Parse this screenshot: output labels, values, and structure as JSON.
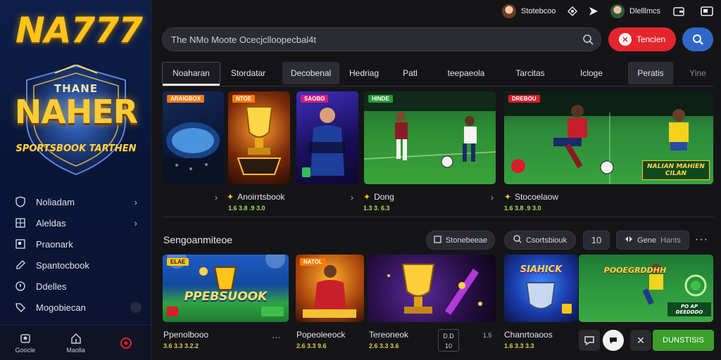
{
  "brand": {
    "logo": "NA777"
  },
  "promo": {
    "top": "THANE",
    "main": "NAHER",
    "sub": "SPORTSBOOK TARTHEN"
  },
  "sidebar": {
    "items": [
      {
        "label": "Noliadam",
        "icon": "shield-icon"
      },
      {
        "label": "Aleldas",
        "icon": "grid-icon"
      },
      {
        "label": "Praonark",
        "icon": "square-icon"
      },
      {
        "label": "Spantocbook",
        "icon": "edit-icon"
      },
      {
        "label": "Ddelles",
        "icon": "circle-info-icon"
      },
      {
        "label": "Mogobiecan",
        "icon": "tag-icon"
      }
    ],
    "bottom": [
      {
        "label": "Goocle",
        "icon": "home-icon"
      },
      {
        "label": "Maolla",
        "icon": "house-outline-icon"
      },
      {
        "label": "",
        "icon": "record-icon"
      }
    ]
  },
  "topbar": {
    "user1": "Stotebcoo",
    "user2": "Dlelllmcs"
  },
  "search": {
    "placeholder": "The NMo Moote Ocecjclloopecbal4t"
  },
  "actions": {
    "red_button": "Tencien"
  },
  "tabs": [
    "Noaharan",
    "Stordatar",
    "Decobenal",
    "Hedriag",
    "Patl",
    "teepaeola",
    "Tarcitas",
    "Icloge",
    "Peratis",
    "Yine"
  ],
  "featured": [
    {
      "tag": "ARAIGBOX",
      "caption": "Anoirrtsbook",
      "odds": "1.6 3.8 .9 3.0"
    },
    {
      "tag": "NTOE",
      "caption": "",
      "odds": ""
    },
    {
      "tag": "SAOBO",
      "caption": "",
      "odds": ""
    },
    {
      "tag": "HINDE",
      "caption": "Dong",
      "odds": "1.3 3. 6.3"
    },
    {
      "tag": "DREBOU",
      "caption": "Stocoelaow",
      "odds": "1.6 3.8 .9 3.0",
      "banner": "NALIAN MAHIEN CILAN"
    }
  ],
  "section": {
    "title": "Sengoanmiteoe",
    "filters": [
      "Stonebeeae",
      "Csortsbiouk",
      "10",
      "Gene",
      "Hants"
    ]
  },
  "games": [
    {
      "tag": "ELAE",
      "title": "PPEBSUOOK",
      "caption": "Ppenolbooo",
      "odds": "3.6 3.3 3.2.2"
    },
    {
      "tag": "NATOL",
      "title": "",
      "caption": "Popeoleeock",
      "odds": "2.6 3.3 9.6"
    },
    {
      "tag": "",
      "title": "",
      "caption": "Tereoneok",
      "odds": "2.6 3.3 3.6"
    },
    {
      "tag": "",
      "title": "SIAHICK",
      "caption": "Chanrtoaoos",
      "odds": "1.6 3.3 3.3"
    },
    {
      "tag": "",
      "title": "POOEGRDDHH",
      "caption": "",
      "odds": "",
      "banner": "PO AP DEEDDDO"
    }
  ],
  "bottom_actions": {
    "box_top": "D.D",
    "box_bottom": "10",
    "side_num": "1.5",
    "green": "DUNSTISIS"
  },
  "colors": {
    "accent_red": "#e3262c",
    "accent_blue": "#2f67c9",
    "accent_green": "#3b9f2a",
    "gold": "#ffc41a"
  }
}
